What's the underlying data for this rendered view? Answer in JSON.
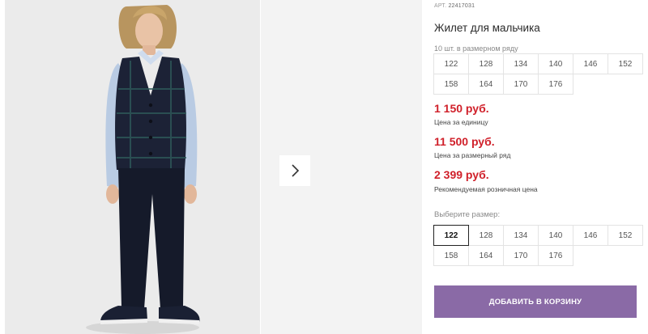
{
  "product": {
    "art_prefix": "АРТ.",
    "article": "22417031",
    "title": "Жилет для мальчика",
    "series_note": "10 шт. в размерном ряду",
    "sizes": [
      "122",
      "128",
      "134",
      "140",
      "146",
      "152",
      "158",
      "164",
      "170",
      "176"
    ]
  },
  "prices": {
    "unit_price": "1 150 руб.",
    "unit_label": "Цена за единицу",
    "series_price": "11 500 руб.",
    "series_label": "Цена за размерный ряд",
    "retail_price": "2 399 руб.",
    "retail_label": "Рекомендуемая розничная цена"
  },
  "size_picker": {
    "label": "Выберите размер:",
    "selected": "122"
  },
  "cart": {
    "button_label": "ДОБАВИТЬ В КОРЗИНУ"
  },
  "colors": {
    "price_red": "#d0202a",
    "cart_purple": "#8a6aa6"
  },
  "icons": {
    "next_arrow": "chevron-right-icon"
  }
}
